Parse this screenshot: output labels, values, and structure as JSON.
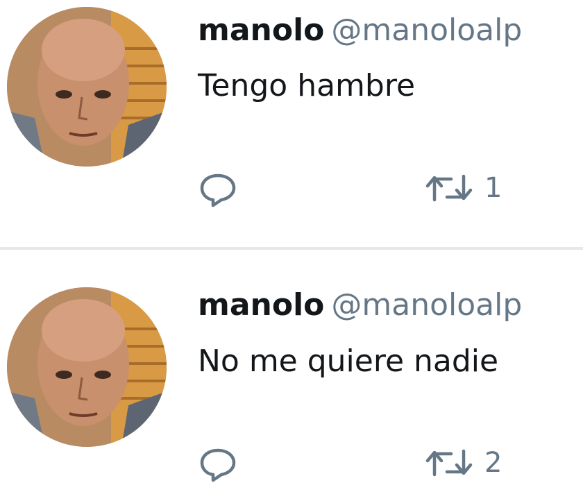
{
  "tweets": [
    {
      "name": "manolo",
      "handle": "@manoloalp",
      "text": "Tengo hambre",
      "retweets": "1",
      "icons": {
        "reply": "reply-icon",
        "retweet": "retweet-icon"
      }
    },
    {
      "name": "manolo",
      "handle": "@manoloalp",
      "text": "No me quiere nadie",
      "retweets": "2",
      "icons": {
        "reply": "reply-icon",
        "retweet": "retweet-icon"
      }
    }
  ],
  "colors": {
    "name": "#14171a",
    "secondary": "#657786",
    "divider": "#e6e9ec",
    "background": "#ffffff"
  }
}
